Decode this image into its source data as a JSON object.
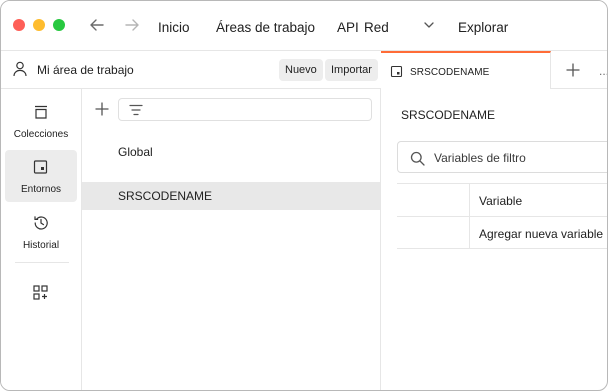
{
  "titlebar": {
    "menu": [
      {
        "id": "inicio",
        "label": "Inicio"
      },
      {
        "id": "areas",
        "label": "Áreas de trabajo"
      },
      {
        "id": "api",
        "label": "API"
      },
      {
        "id": "red",
        "label": "Red"
      },
      {
        "id": "explorar",
        "label": "Explorar"
      }
    ]
  },
  "workspace": {
    "name": "Mi área de trabajo",
    "new_label": "Nuevo",
    "import_label": "Importar"
  },
  "rail": {
    "items": [
      {
        "label": "Colecciones",
        "icon": "trash-collections-icon",
        "active": false
      },
      {
        "label": "Entornos",
        "icon": "environment-icon",
        "active": true
      },
      {
        "label": "Historial",
        "icon": "history-icon",
        "active": false
      }
    ],
    "extra_icon": "add-widget-icon"
  },
  "environments": {
    "items": [
      {
        "label": "Global",
        "selected": false
      },
      {
        "label": "SRSCODENAME",
        "selected": true
      }
    ]
  },
  "tab": {
    "label": "SRSCODENAME",
    "more": "..."
  },
  "content": {
    "title": "SRSCODENAME",
    "search_placeholder": "Variables de filtro",
    "table": {
      "header": "Variable",
      "add_row": "Agregar nueva variable"
    }
  },
  "colors": {
    "accent": "#ff6c37",
    "selected_bg": "#e8e8e8",
    "close": "#fe5f57",
    "minimize": "#febc2e",
    "zoom": "#28c840"
  }
}
